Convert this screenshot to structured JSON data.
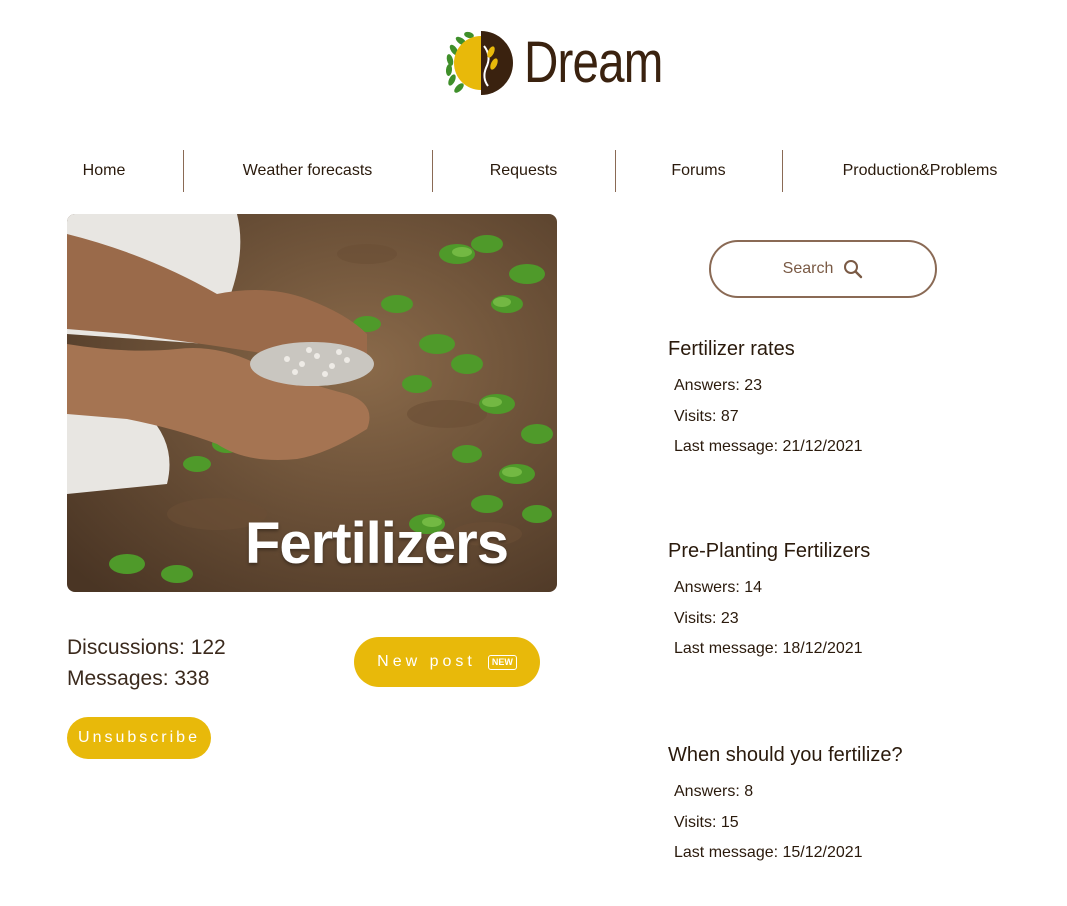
{
  "logo": {
    "text": "Dream",
    "icon": "wheat-leaf-logo-icon"
  },
  "nav": [
    {
      "label": "Home"
    },
    {
      "label": "Weather forecasts"
    },
    {
      "label": "Requests"
    },
    {
      "label": "Forums"
    },
    {
      "label": "Production&Problems"
    }
  ],
  "hero": {
    "title": "Fertilizers",
    "image": "hands-holding-fertilizer-granules-over-crops"
  },
  "stats": {
    "discussions": "Discussions: 122",
    "messages": "Messages: 338"
  },
  "buttons": {
    "new_post": "New post",
    "new_badge": "NEW",
    "unsubscribe": "Unsubscribe"
  },
  "search": {
    "label": "Search",
    "icon": "search-icon"
  },
  "topics": [
    {
      "title": "Fertilizer rates",
      "answers": "Answers: 23",
      "visits": "Visits: 87",
      "last": "Last message: 21/12/2021"
    },
    {
      "title": "Pre-Planting Fertilizers",
      "answers": "Answers: 14",
      "visits": "Visits: 23",
      "last": "Last message: 18/12/2021"
    },
    {
      "title": "When should you fertilize?",
      "answers": "Answers: 8",
      "visits": "Visits: 15",
      "last": "Last message: 15/12/2021"
    }
  ],
  "colors": {
    "accent": "#e8b90a",
    "brand_brown": "#3a220f",
    "search_border": "#8a6a55"
  }
}
